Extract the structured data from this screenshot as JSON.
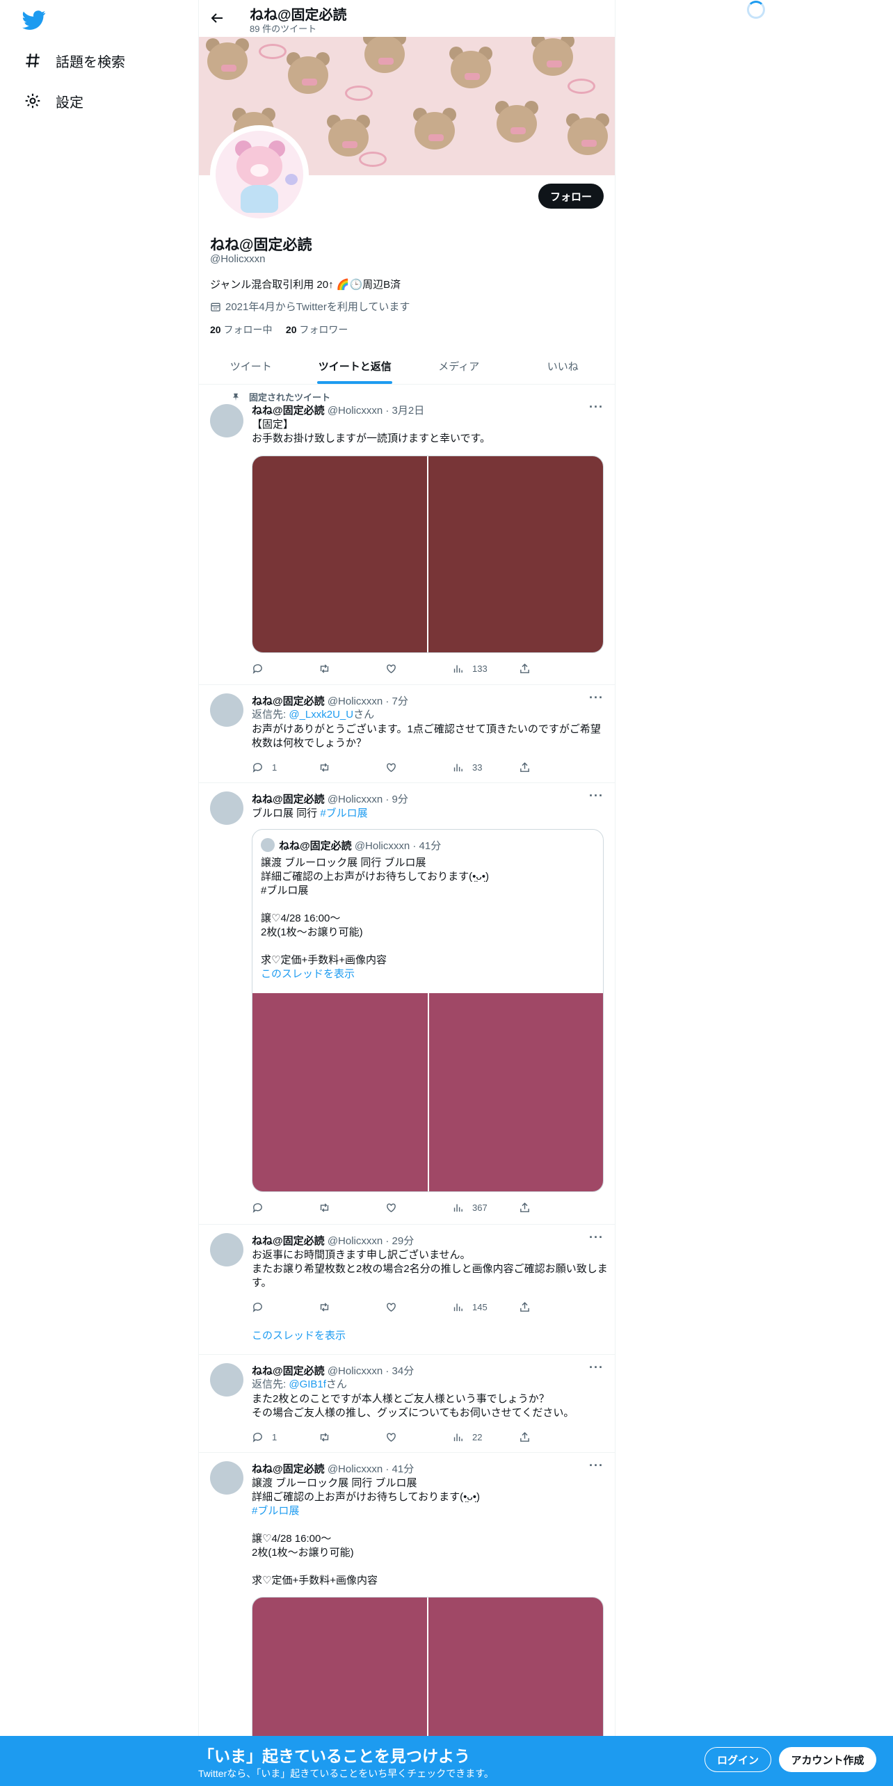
{
  "nav": {
    "explore_label": "話題を検索",
    "settings_label": "設定"
  },
  "header": {
    "name": "ねね@固定必読",
    "tweet_count": "89 件のツイート"
  },
  "profile": {
    "follow_label": "フォロー",
    "name": "ねね@固定必読",
    "handle": "@Holicxxxn",
    "bio": "ジャンル混合取引利用 20↑ 🌈🕒周辺B済",
    "joined": "2021年4月からTwitterを利用しています",
    "following_count": "20",
    "following_label": "フォロー中",
    "followers_count": "20",
    "followers_label": "フォロワー"
  },
  "tabs": [
    "ツイート",
    "ツイートと返信",
    "メディア",
    "いいね"
  ],
  "tweets": [
    {
      "pinned_label": "固定されたツイート",
      "name": "ねね@固定必読",
      "meta": "@Holicxxxn · 3月2日",
      "lines": [
        "【固定】",
        "お手数お掛け致しますが一読頂けますと幸いです。"
      ],
      "media_color": "#783537",
      "views": "133"
    },
    {
      "name": "ねね@固定必読",
      "meta": "@Holicxxxn · 7分",
      "reply_prefix": "返信先: ",
      "reply_to": "@_Lxxk2U_U",
      "reply_suffix": "さん",
      "lines": [
        "お声がけありがとうございます。1点ご確認させて頂きたいのですがご希望",
        "枚数は何枚でしょうか？"
      ],
      "replies": "1",
      "views": "33"
    },
    {
      "name": "ねね@固定必読",
      "meta": "@Holicxxxn · 9分",
      "text": "ブルロ展 同行 ",
      "hashtag": "#ブルロ展",
      "quote": {
        "name": "ねね@固定必読",
        "meta": "@Holicxxxn · 41分",
        "lines": [
          "譲渡 ブルーロック展 同行 ブルロ展",
          "詳細ご確認の上お声がけお待ちしております(•̤ᴗ•̤)",
          "#ブルロ展",
          "",
          "譲♡4/28 16:00～",
          "2枚(1枚～お譲り可能)",
          "",
          "求♡定価+手数料+画像内容"
        ],
        "show_thread": "このスレッドを表示",
        "media_color": "#a04866"
      },
      "views": "367"
    },
    {
      "name": "ねね@固定必読",
      "meta": "@Holicxxxn · 29分",
      "lines": [
        "お返事にお時間頂きます申し訳ございません。",
        "またお譲り希望枚数と2枚の場合2名分の推しと画像内容ご確認お願い致しま",
        "す。"
      ],
      "views": "145",
      "show_thread": "このスレッドを表示"
    },
    {
      "name": "ねね@固定必読",
      "meta": "@Holicxxxn · 34分",
      "reply_prefix": "返信先: ",
      "reply_to": "@GIB1f",
      "reply_suffix": "さん",
      "lines": [
        "また2枚とのことですが本人様とご友人様という事でしょうか？",
        "その場合ご友人様の推し、グッズについてもお伺いさせてください。"
      ],
      "replies": "1",
      "views": "22"
    },
    {
      "name": "ねね@固定必読",
      "meta": "@Holicxxxn · 41分",
      "lines": [
        "譲渡 ブルーロック展 同行 ブルロ展",
        "詳細ご確認の上お声がけお待ちしております(•̤ᴗ•̤)"
      ],
      "hashtag": "#ブルロ展",
      "lines2": [
        "譲♡4/28 16:00～",
        "2枚(1枚～お譲り可能)",
        "",
        "求♡定価+手数料+画像内容"
      ],
      "media_color": "#a04866"
    }
  ],
  "bottom_bar": {
    "title": "「いま」起きていることを見つけよう",
    "subtitle": "Twitterなら、「いま」起きていることをいち早くチェックできます。",
    "login_label": "ログイン",
    "signup_label": "アカウント作成"
  },
  "colors": {
    "accent": "#1d9bf0",
    "bottom_bar": "#1d9bf0",
    "banner": "#f3dcdd"
  }
}
